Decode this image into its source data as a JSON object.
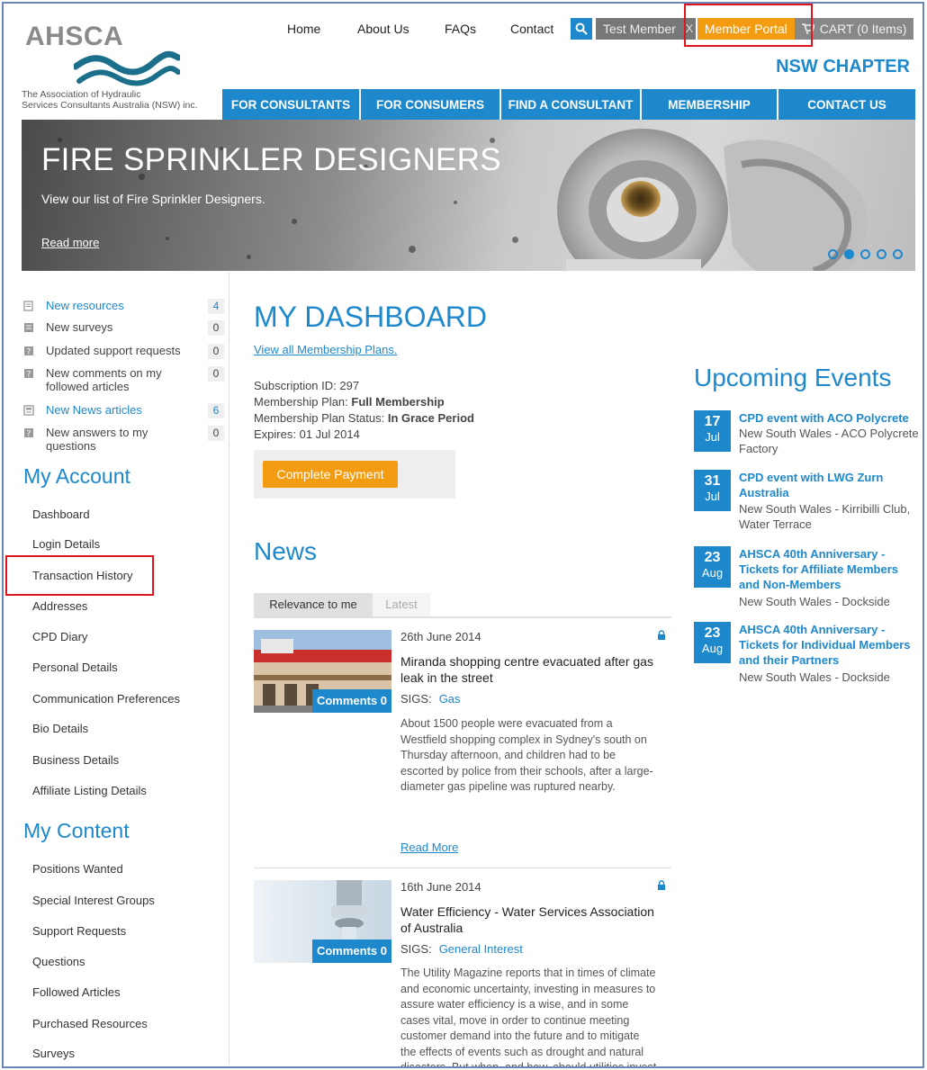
{
  "logo": {
    "name": "AHSCA",
    "subtitle_line1": "The Association of Hydraulic",
    "subtitle_line2": "Services Consultants Australia (NSW) inc."
  },
  "topnav": {
    "home": "Home",
    "about": "About Us",
    "faqs": "FAQs",
    "contact": "Contact"
  },
  "userbar": {
    "member": "Test Member",
    "logout": "X",
    "portal": "Member Portal",
    "cart": "CART (0 Items)"
  },
  "chapter": "NSW CHAPTER",
  "mainnav": [
    "FOR CONSULTANTS",
    "FOR CONSUMERS",
    "FIND A CONSULTANT",
    "MEMBERSHIP",
    "CONTACT US"
  ],
  "banner": {
    "title": "FIRE SPRINKLER DESIGNERS",
    "subtitle": "View our list of Fire Sprinkler Designers.",
    "read_more": "Read more"
  },
  "notifications": [
    {
      "label_1": "New resources",
      "label_2": "",
      "count": "4",
      "highlight": true
    },
    {
      "label_1": "New surveys",
      "label_2": "",
      "count": "0",
      "highlight": false
    },
    {
      "label_1": "Updated support requests",
      "label_2": "",
      "count": "0",
      "highlight": false
    },
    {
      "label_1": "New comments on my",
      "label_2": "followed articles",
      "count": "0",
      "highlight": false
    },
    {
      "label_1": "New News articles",
      "label_2": "",
      "count": "6",
      "highlight": true
    },
    {
      "label_1": "New answers to my",
      "label_2": "questions",
      "count": "0",
      "highlight": false
    }
  ],
  "my_account": {
    "heading": "My Account",
    "links": [
      "Dashboard",
      "Login Details",
      "Transaction History",
      "Addresses",
      "CPD Diary",
      "Personal Details",
      "Communication Preferences",
      "Bio Details",
      "Business Details",
      "Affiliate Listing Details"
    ]
  },
  "my_content": {
    "heading": "My Content",
    "links": [
      "Positions Wanted",
      "Special Interest Groups",
      "Support Requests",
      "Questions",
      "Followed Articles",
      "Purchased Resources",
      "Surveys"
    ]
  },
  "dashboard": {
    "title": "MY DASHBOARD",
    "plans_link": "View all Membership Plans",
    "subscription_label": "Subscription ID:",
    "subscription_id": "297",
    "plan_label": "Membership Plan:",
    "plan": "Full Membership",
    "status_label": "Membership Plan Status:",
    "status": "In Grace Period",
    "expires_label": "Expires:",
    "expires": "01 Jul 2014",
    "pay_button": "Complete Payment"
  },
  "news": {
    "heading": "News",
    "tab_relevance": "Relevance to me",
    "tab_latest": "Latest",
    "articles": [
      {
        "date": "26th June 2014",
        "title_1": "Miranda shopping centre evacuated after gas",
        "title_2": "leak in the street",
        "sigs_label": "SIGS:",
        "sig": "Gas",
        "comments": "Comments 0",
        "body": [
          "About 1500 people were evacuated from a",
          "Westfield shopping complex in Sydney's south on",
          "Thursday afternoon, and children had to be",
          "escorted by police from their schools, after a large-",
          "diameter gas pipeline was ruptured nearby."
        ],
        "read_more": "Read More"
      },
      {
        "date": "16th June 2014",
        "title_1": "Water Efficiency - Water Services Association",
        "title_2": "of Australia",
        "sigs_label": "SIGS:",
        "sig": "General Interest",
        "comments": "Comments 0",
        "body": [
          "The Utility Magazine reports that in times of climate",
          "and economic uncertainty, investing in measures to",
          "assure water efficiency is a wise, and in some",
          "cases vital, move in order to continue meeting",
          "customer demand into the future and to mitigate",
          "the effects of events such as drought and natural",
          "disasters. But when, and how, should utilities invest"
        ],
        "read_more": ""
      }
    ]
  },
  "events": {
    "heading": "Upcoming Events",
    "items": [
      {
        "day": "17",
        "month": "Jul",
        "title": [
          "CPD event with ACO Polycrete"
        ],
        "location": [
          "New South Wales - ACO Polycrete",
          "Factory"
        ]
      },
      {
        "day": "31",
        "month": "Jul",
        "title": [
          "CPD event with LWG Zurn",
          "Australia"
        ],
        "location": [
          "New South Wales - Kirribilli Club,",
          "Water Terrace"
        ]
      },
      {
        "day": "23",
        "month": "Aug",
        "title": [
          "AHSCA 40th Anniversary -",
          "Tickets for Affiliate Members",
          "and Non-Members"
        ],
        "location": [
          "New South Wales - Dockside"
        ]
      },
      {
        "day": "23",
        "month": "Aug",
        "title": [
          "AHSCA 40th Anniversary -",
          "Tickets for Individual Members",
          "and their Partners"
        ],
        "location": [
          "New South Wales - Dockside"
        ]
      }
    ]
  },
  "colors": {
    "brand_blue": "#1e88cc",
    "accent_orange": "#f39c12",
    "highlight_red": "#e0141e"
  },
  "icons": {
    "search": "search-icon",
    "cart": "cart-icon",
    "lock": "lock-icon",
    "notification": "document-icon"
  }
}
